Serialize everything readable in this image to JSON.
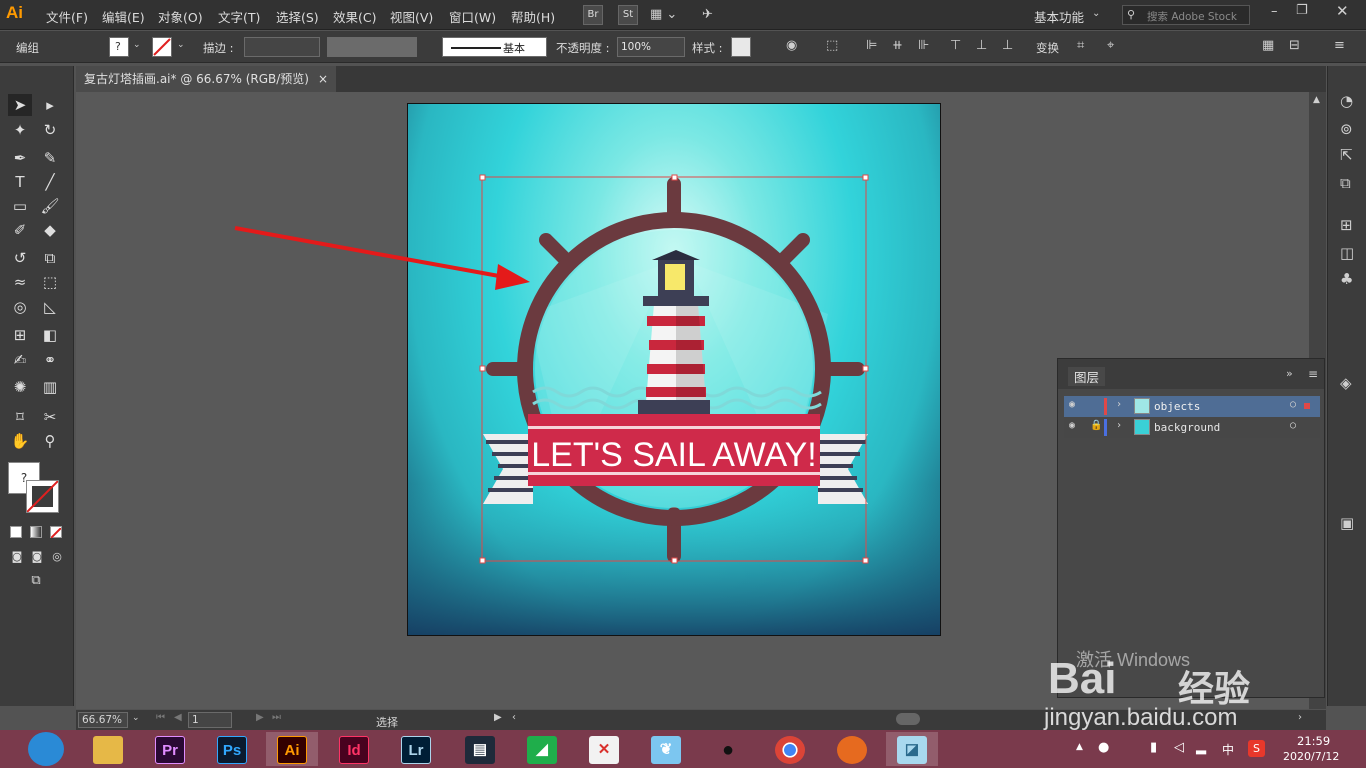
{
  "app": {
    "logo": "Ai"
  },
  "menu": [
    "文件(F)",
    "编辑(E)",
    "对象(O)",
    "文字(T)",
    "选择(S)",
    "效果(C)",
    "视图(V)",
    "窗口(W)",
    "帮助(H)"
  ],
  "app_bar": {
    "br_label": "Br",
    "st_label": "St",
    "workspace": "基本功能",
    "search_placeholder": "搜索 Adobe Stock"
  },
  "control_bar": {
    "group_label": "编组",
    "stroke_label": "描边 :",
    "basic_label": "基本",
    "opacity_label": "不透明度 :",
    "opacity_value": "100%",
    "style_label": "样式 :",
    "transform_label": "变换"
  },
  "document_tab": {
    "title": "复古灯塔插画.ai* @ 66.67% (RGB/预览)",
    "close": "×"
  },
  "artwork": {
    "banner_text": "LET'S SAIL AWAY!"
  },
  "layers_panel": {
    "title": "图层",
    "layers": [
      {
        "name": "objects",
        "color": "#e04848",
        "selected": true
      },
      {
        "name": "background",
        "color": "#4a6fe0",
        "locked": true
      }
    ]
  },
  "status_bar": {
    "zoom": "66.67%",
    "page": "1",
    "tool_name": "选择"
  },
  "taskbar": {
    "apps": [
      "Pr",
      "Ps",
      "Ai",
      "Id",
      "Lr"
    ],
    "ime": "中",
    "time": "21:59",
    "date": "2020/7/12"
  },
  "watermark": {
    "activate_text": "激活 Windows",
    "site": "jingyan.baidu.com",
    "brand": "Bai",
    "brand_cn": "经验"
  },
  "colors": {
    "accent_ai": "#ff9a00",
    "selection": "#e04848",
    "taskbar": "#7a3a4c"
  }
}
